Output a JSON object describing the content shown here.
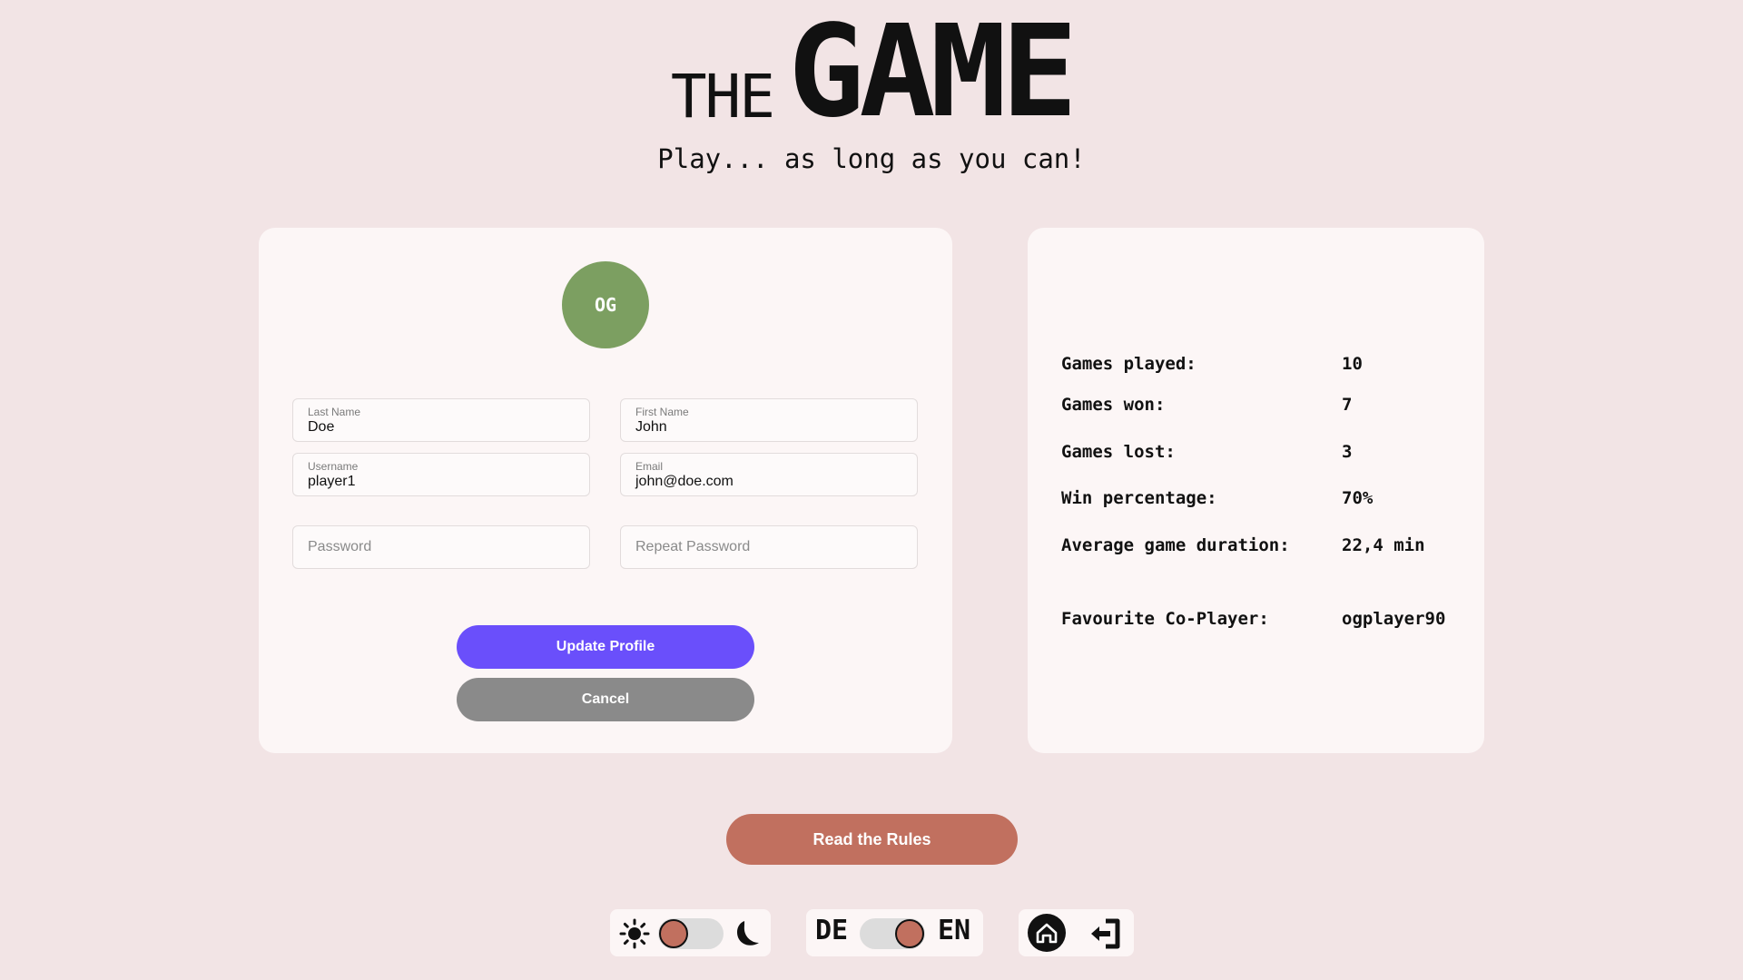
{
  "header": {
    "title_small": "THE",
    "title_big": "GAME",
    "subtitle": "Play... as long as you can!"
  },
  "profile": {
    "avatar_initials": "OG",
    "avatar_color": "#7c9f61",
    "fields": {
      "last_name": {
        "label": "Last Name",
        "value": "Doe"
      },
      "first_name": {
        "label": "First Name",
        "value": "John"
      },
      "username": {
        "label": "Username",
        "value": "player1"
      },
      "email": {
        "label": "Email",
        "value": "john@doe.com"
      },
      "password": {
        "placeholder": "Password"
      },
      "repeat_password": {
        "placeholder": "Repeat Password"
      }
    },
    "update_label": "Update Profile",
    "cancel_label": "Cancel"
  },
  "stats": {
    "games_played": {
      "label": "Games played:",
      "value": "10"
    },
    "games_won": {
      "label": "Games won:",
      "value": "7"
    },
    "games_lost": {
      "label": "Games lost:",
      "value": "3"
    },
    "win_percentage": {
      "label": "Win percentage:",
      "value": "70%"
    },
    "avg_duration": {
      "label": "Average game duration:",
      "value": "22,4 min"
    },
    "favourite_coplayer": {
      "label": "Favourite Co-Player:",
      "value": "ogplayer90"
    }
  },
  "rules_label": "Read the Rules",
  "footer": {
    "theme_toggle": {
      "left_icon": "sun-icon",
      "right_icon": "moon-icon",
      "state": "light"
    },
    "language_toggle": {
      "left": "DE",
      "right": "EN",
      "state": "EN"
    },
    "nav": {
      "home_icon": "home-icon",
      "logout_icon": "logout-icon"
    }
  },
  "colors": {
    "background": "#f2e4e5",
    "card": "#fcf6f6",
    "primary_button": "#6a4ffb",
    "cancel_button": "#8a8a8a",
    "accent": "#c1705f",
    "avatar": "#7c9f61"
  }
}
